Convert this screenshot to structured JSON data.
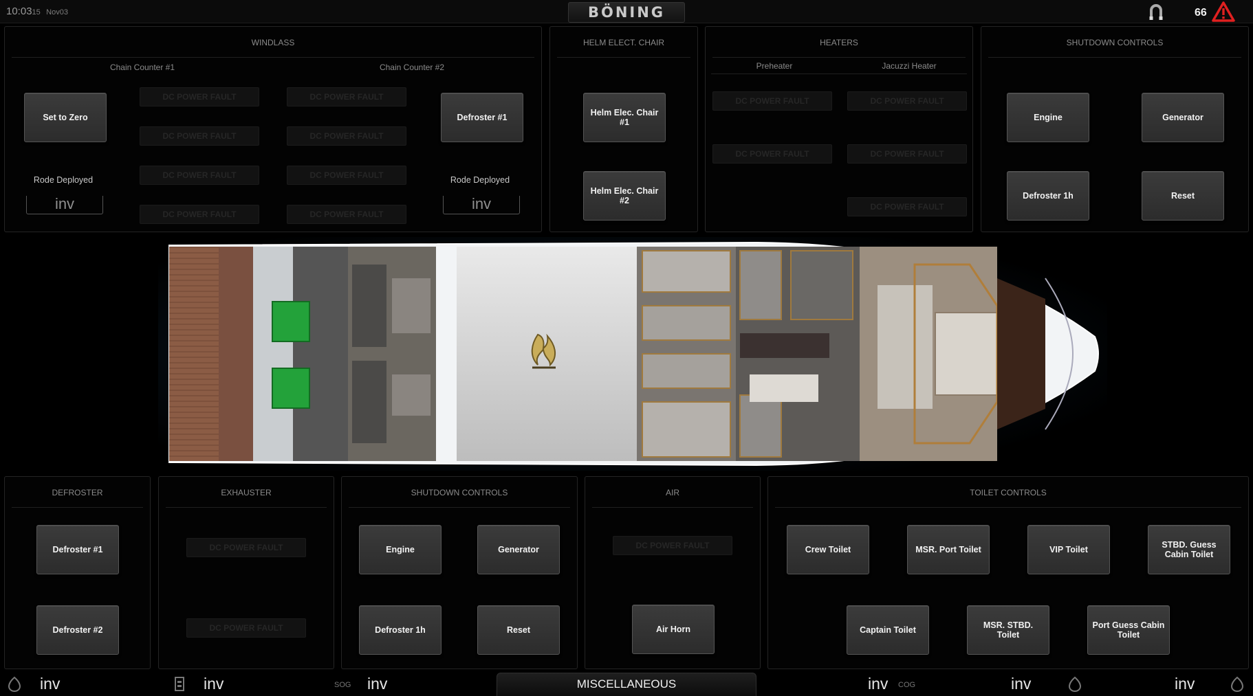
{
  "header": {
    "time": "10:03",
    "seconds": "15",
    "date": "Nov03",
    "logo": "BÖNING",
    "alarm_count": "66",
    "icons": {
      "anchor": "magnet-icon",
      "alarm": "warning-triangle-icon"
    },
    "colors": {
      "alarm": "#e02020"
    }
  },
  "windlass": {
    "title": "WINDLASS",
    "chain1": "Chain Counter #1",
    "chain2": "Chain Counter #2",
    "set_zero": "Set to Zero",
    "defroster1": "Defroster #1",
    "rode1": "Rode Deployed",
    "rode2": "Rode Deployed",
    "inv1": "inv",
    "inv2": "inv",
    "fault": "DC POWER FAULT"
  },
  "helm": {
    "title": "HELM ELECT. CHAIR",
    "chair1": "Helm Elec. Chair #1",
    "chair2": "Helm Elec. Chair #2"
  },
  "heaters": {
    "title": "HEATERS",
    "pre": "Preheater",
    "jacuzzi": "Jacuzzi Heater",
    "fault": "DC POWER FAULT"
  },
  "shutdown_top": {
    "title": "SHUTDOWN CONTROLS",
    "engine": "Engine",
    "generator": "Generator",
    "defroster": "Defroster 1h",
    "reset": "Reset"
  },
  "boat": {
    "fire_icon": "fire-icon",
    "colors": {
      "deck": "#8a5a44",
      "hull": "#f2f4f6",
      "green": "#23a23a"
    }
  },
  "defroster": {
    "title": "DEFROSTER",
    "d1": "Defroster #1",
    "d2": "Defroster #2"
  },
  "exhauster": {
    "title": "EXHAUSTER",
    "fault": "DC POWER FAULT"
  },
  "shutdown_bottom": {
    "title": "SHUTDOWN CONTROLS",
    "engine": "Engine",
    "generator": "Generator",
    "defroster": "Defroster 1h",
    "reset": "Reset"
  },
  "air": {
    "title": "AIR",
    "fault": "DC POWER FAULT",
    "horn": "Air Horn"
  },
  "toilet": {
    "title": "TOILET CONTROLS",
    "crew": "Crew Toilet",
    "msr_port": "MSR. Port Toilet",
    "vip": "VIP Toilet",
    "stbd_guest": "STBD. Guess Cabin Toilet",
    "captain": "Captain Toilet",
    "msr_stbd": "MSR. STBD. Toilet",
    "port_guest": "Port Guess Cabin Toilet"
  },
  "footer": {
    "v1": "inv",
    "v2": "inv",
    "sog": "SOG",
    "v3": "inv",
    "tab": "MISCELLANEOUS",
    "v4": "inv",
    "cog": "COG",
    "v5": "inv",
    "v6": "inv",
    "icons": [
      "tank-icon",
      "battery-icon",
      "tank-icon",
      "tank-icon"
    ]
  }
}
